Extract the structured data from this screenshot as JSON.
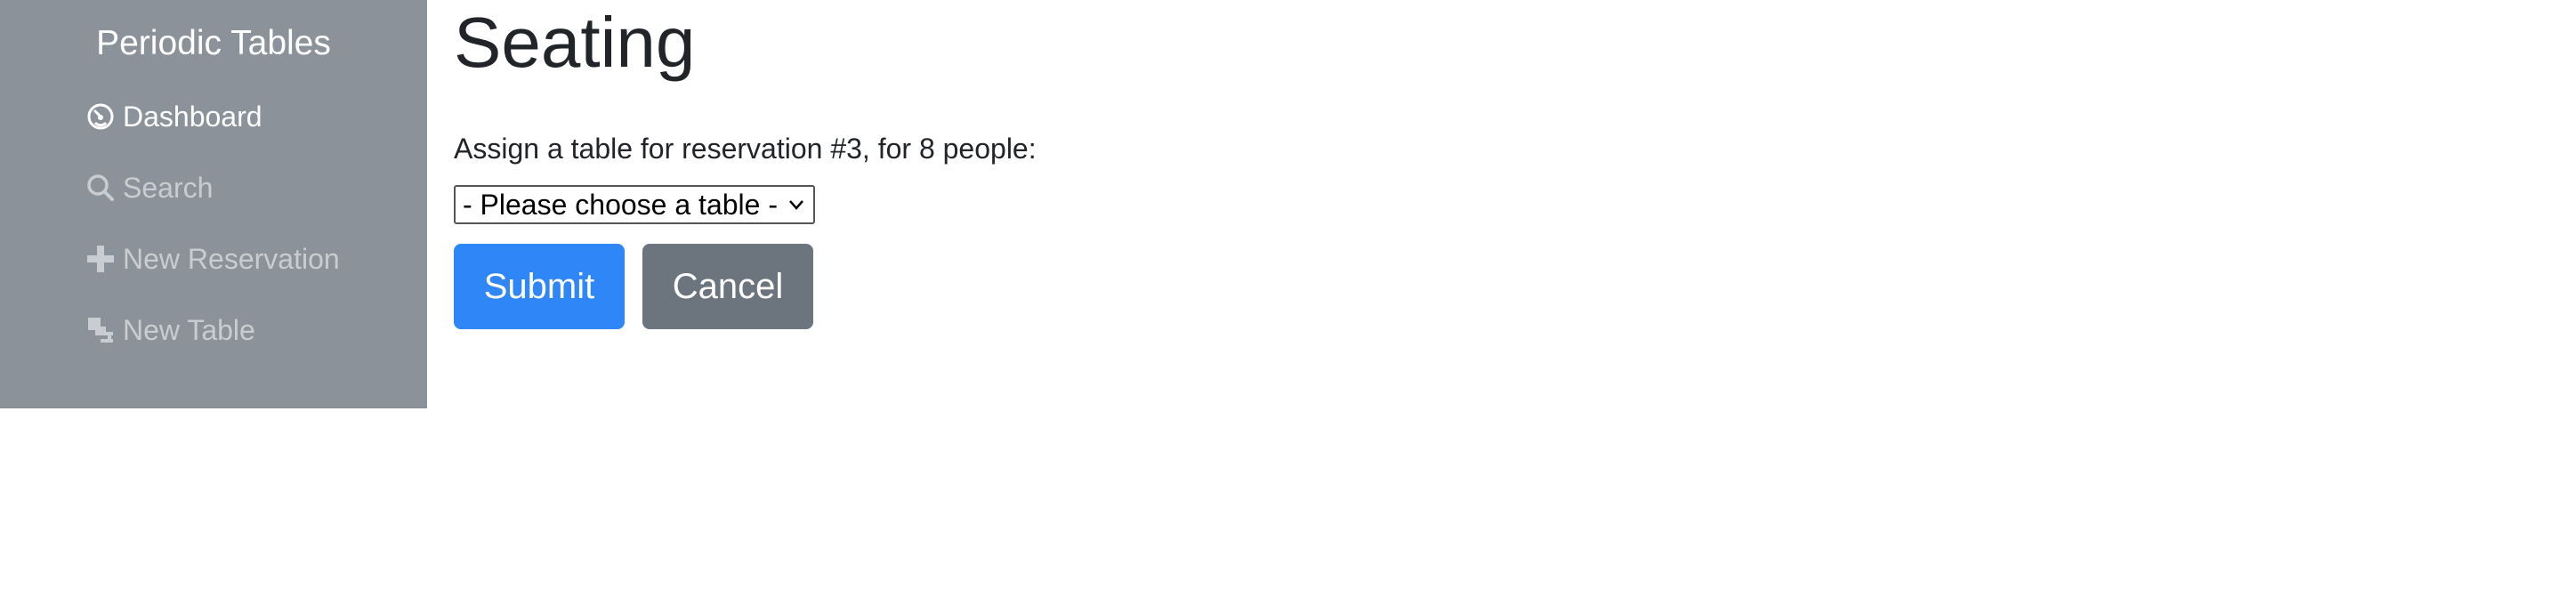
{
  "sidebar": {
    "brand": "Periodic Tables",
    "items": [
      {
        "label": "Dashboard",
        "icon": "dashboard-icon",
        "active": true
      },
      {
        "label": "Search",
        "icon": "search-icon",
        "active": false
      },
      {
        "label": "New Reservation",
        "icon": "plus-icon",
        "active": false
      },
      {
        "label": "New Table",
        "icon": "new-table-icon",
        "active": false
      }
    ],
    "background_color": "#8b9299"
  },
  "main": {
    "title": "Seating",
    "assign_text": "Assign a table for reservation #3, for 8 people:",
    "table_select": {
      "selected": "- Please choose a table -"
    },
    "submit_label": "Submit",
    "cancel_label": "Cancel",
    "submit_color": "#2f86f6",
    "cancel_color": "#6c757d"
  }
}
